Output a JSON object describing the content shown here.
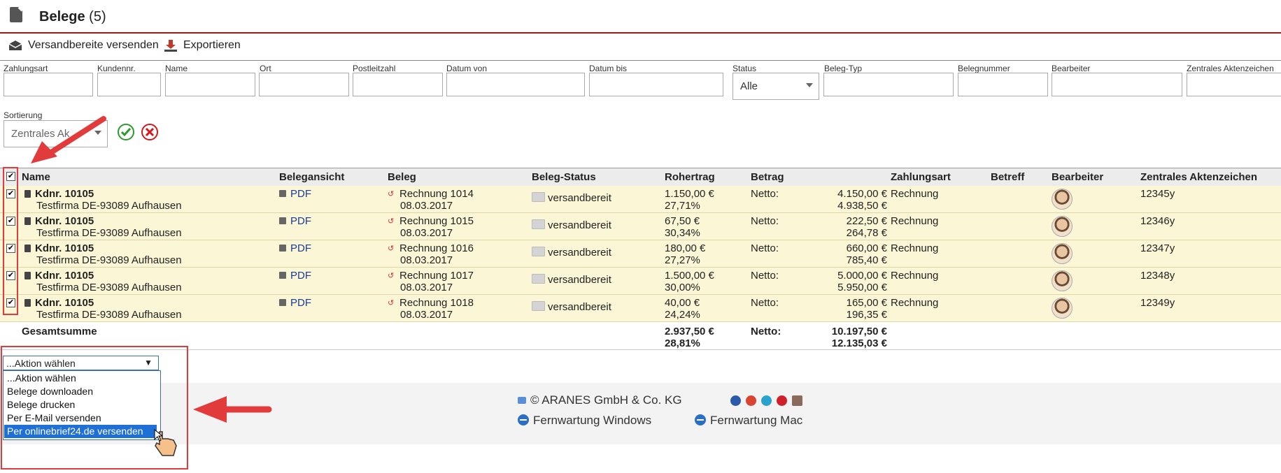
{
  "header": {
    "title": "Belege",
    "count": "(5)"
  },
  "toolbar": {
    "send_label": "Versandbereite versenden",
    "export_label": "Exportieren"
  },
  "filters": {
    "zahlungsart": "Zahlungsart",
    "kundennr": "Kundennr.",
    "name": "Name",
    "ort": "Ort",
    "plz": "Postleitzahl",
    "datum_von": "Datum von",
    "datum_bis": "Datum bis",
    "status": "Status",
    "status_value": "Alle",
    "belegtyp": "Beleg-Typ",
    "belegnummer": "Belegnummer",
    "bearbeiter": "Bearbeiter",
    "aktenzeichen": "Zentrales Aktenzeichen",
    "sortierung": "Sortierung",
    "sortierung_value": "Zentrales Ak"
  },
  "table": {
    "headers": {
      "name": "Name",
      "belegansicht": "Belegansicht",
      "beleg": "Beleg",
      "status": "Beleg-Status",
      "rohertrag": "Rohertrag",
      "betrag": "Betrag",
      "zahlungsart": "Zahlungsart",
      "betreff": "Betreff",
      "bearbeiter": "Bearbeiter",
      "aktenzeichen": "Zentrales Aktenzeichen"
    },
    "rows": [
      {
        "kdnr": "Kdnr. 10105",
        "firma": "Testfirma DE-93089 Aufhausen",
        "pdf": "PDF",
        "beleg": "Rechnung 1014",
        "datum": "08.03.2017",
        "status": "versandbereit",
        "roh1": "1.150,00 €",
        "roh2": "27,71%",
        "netto": "Netto:",
        "betrag1": "4.150,00 €",
        "betrag2": "4.938,50 €",
        "zahlungsart": "Rechnung",
        "az": "12345y"
      },
      {
        "kdnr": "Kdnr. 10105",
        "firma": "Testfirma DE-93089 Aufhausen",
        "pdf": "PDF",
        "beleg": "Rechnung 1015",
        "datum": "08.03.2017",
        "status": "versandbereit",
        "roh1": "67,50 €",
        "roh2": "30,34%",
        "netto": "Netto:",
        "betrag1": "222,50 €",
        "betrag2": "264,78 €",
        "zahlungsart": "Rechnung",
        "az": "12346y"
      },
      {
        "kdnr": "Kdnr. 10105",
        "firma": "Testfirma DE-93089 Aufhausen",
        "pdf": "PDF",
        "beleg": "Rechnung 1016",
        "datum": "08.03.2017",
        "status": "versandbereit",
        "roh1": "180,00 €",
        "roh2": "27,27%",
        "netto": "Netto:",
        "betrag1": "660,00 €",
        "betrag2": "785,40 €",
        "zahlungsart": "Rechnung",
        "az": "12347y"
      },
      {
        "kdnr": "Kdnr. 10105",
        "firma": "Testfirma DE-93089 Aufhausen",
        "pdf": "PDF",
        "beleg": "Rechnung 1017",
        "datum": "08.03.2017",
        "status": "versandbereit",
        "roh1": "1.500,00 €",
        "roh2": "30,00%",
        "netto": "Netto:",
        "betrag1": "5.000,00 €",
        "betrag2": "5.950,00 €",
        "zahlungsart": "Rechnung",
        "az": "12348y"
      },
      {
        "kdnr": "Kdnr. 10105",
        "firma": "Testfirma DE-93089 Aufhausen",
        "pdf": "PDF",
        "beleg": "Rechnung 1018",
        "datum": "08.03.2017",
        "status": "versandbereit",
        "roh1": "40,00 €",
        "roh2": "24,24%",
        "netto": "Netto:",
        "betrag1": "165,00 €",
        "betrag2": "196,35 €",
        "zahlungsart": "Rechnung",
        "az": "12349y"
      }
    ],
    "summary": {
      "label": "Gesamtsumme",
      "roh1": "2.937,50 €",
      "roh2": "28,81%",
      "netto": "Netto:",
      "betrag1": "10.197,50 €",
      "betrag2": "12.135,03 €"
    }
  },
  "action": {
    "selected": "...Aktion wählen",
    "options": [
      "...Aktion wählen",
      "Belege downloaden",
      "Belege drucken",
      "Per E-Mail versenden",
      "Per onlinebrief24.de versenden"
    ]
  },
  "footer": {
    "copyright": "© ARANES GmbH & Co. KG",
    "remote_windows": "Fernwartung Windows",
    "remote_mac": "Fernwartung Mac"
  },
  "colors": {
    "accent": "#9b1b1b",
    "row_bg": "#fbf7d6",
    "annotation_red": "#e23b3b",
    "link": "#1a3a9a",
    "option_selected": "#1e6fd6"
  }
}
